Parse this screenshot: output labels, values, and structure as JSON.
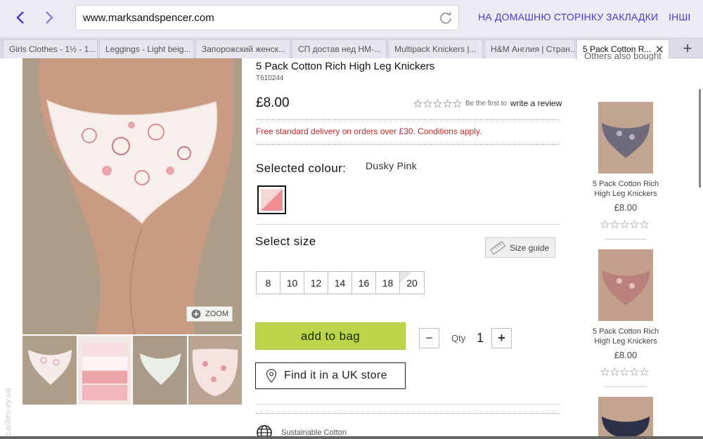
{
  "browser": {
    "url": "www.marksandspencer.com",
    "nav_links": [
      "НА ДОМАШНЮ СТОРІНКУ",
      "ЗАКЛАДКИ",
      "ІНШІ"
    ],
    "tabs": [
      "Girls Clothes - 1½ - 1...",
      "Leggings - Light beig...",
      "Запорожский женск...",
      "СП достав нед HM-...",
      "Multipack Knickers |...",
      "H&M Англия | Стран...",
      "5 Pack Cotton R..."
    ],
    "active_tab_index": 6
  },
  "product": {
    "title": "5 Pack Cotton Rich High Leg Knickers",
    "sku": "T610244",
    "price": "£8.00",
    "rating": {
      "stars": 0,
      "max": 5,
      "prompt": "Be the first to",
      "link": "write a review"
    },
    "delivery": "Free standard delivery on orders over £30. Conditions apply.",
    "selected_colour_label": "Selected colour:",
    "selected_colour_value": "Dusky Pink",
    "select_size_label": "Select size",
    "size_guide_label": "Size guide",
    "sizes": [
      "8",
      "10",
      "12",
      "14",
      "16",
      "18",
      "20"
    ],
    "add_to_bag": "add to bag",
    "qty_label": "Qty",
    "qty_value": "1",
    "find_store": "Find it in a UK store",
    "sustainable": "Sustainable Cotton",
    "zoom_label": "ZOOM"
  },
  "also_bought": {
    "heading": "Others also bought",
    "items": [
      {
        "name": "5 Pack Cotton Rich High Leg Knickers",
        "price": "£8.00",
        "stars": 0
      },
      {
        "name": "5 Pack Cotton Rich High Leg Knickers",
        "price": "£8.00",
        "stars": 0
      },
      {
        "name": "",
        "price": "",
        "stars": 0
      }
    ]
  },
  "watermark": "Ladies-ey.ua",
  "colors": {
    "nav_link": "#4a3ad0",
    "delivery": "#c62828",
    "add_to_bag": "#bcd44a"
  }
}
